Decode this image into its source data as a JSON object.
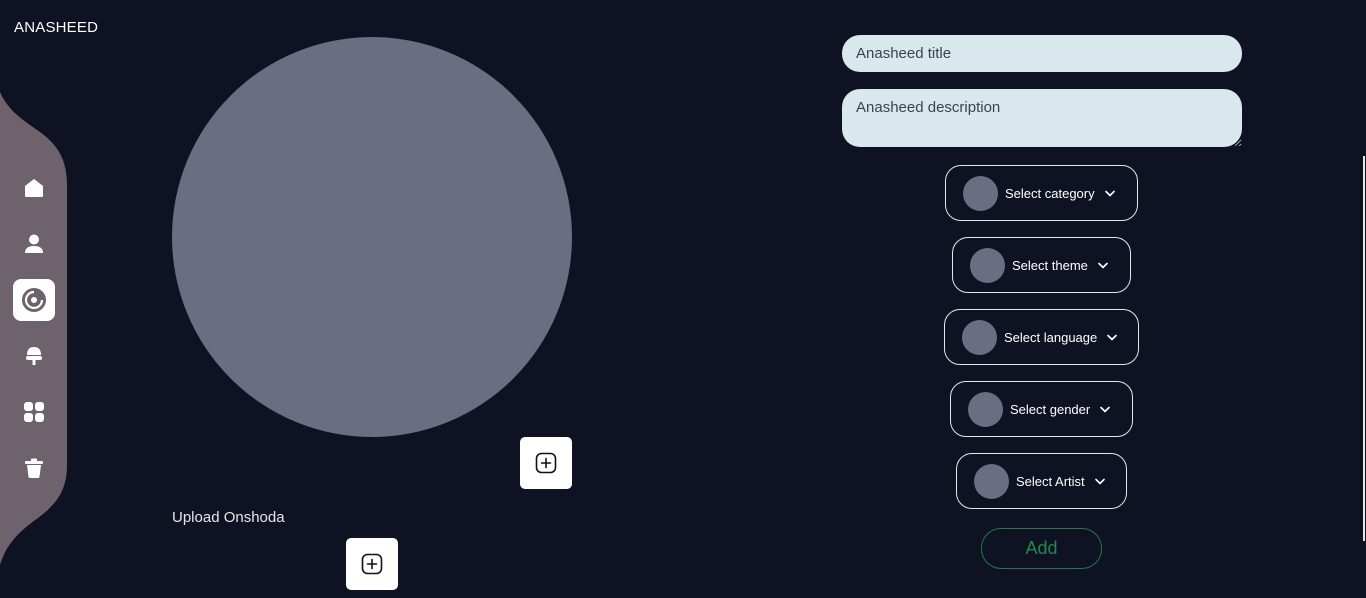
{
  "app": {
    "brand": "ANASHEED"
  },
  "sidebar": {
    "items": [
      {
        "icon": "home-icon",
        "active": false
      },
      {
        "icon": "user-icon",
        "active": false
      },
      {
        "icon": "disc-icon",
        "active": true
      },
      {
        "icon": "microphone-icon",
        "active": false
      },
      {
        "icon": "grid-icon",
        "active": false
      },
      {
        "icon": "trash-icon",
        "active": false
      }
    ]
  },
  "upload": {
    "label": "Upload Onshoda",
    "add_icon": "plus-square-icon"
  },
  "form": {
    "title_placeholder": "Anasheed title",
    "description_placeholder": "Anasheed description",
    "selects": {
      "category": "Select category",
      "theme": "Select theme",
      "language": "Select language",
      "gender": "Select gender",
      "artist": "Select Artist"
    },
    "add_label": "Add"
  },
  "colors": {
    "background": "#0f1222",
    "sidebar": "#6e626d",
    "placeholder_circle": "#6b6e82",
    "input_bg": "#d8e8ec",
    "add_green": "#1f8a4f"
  }
}
